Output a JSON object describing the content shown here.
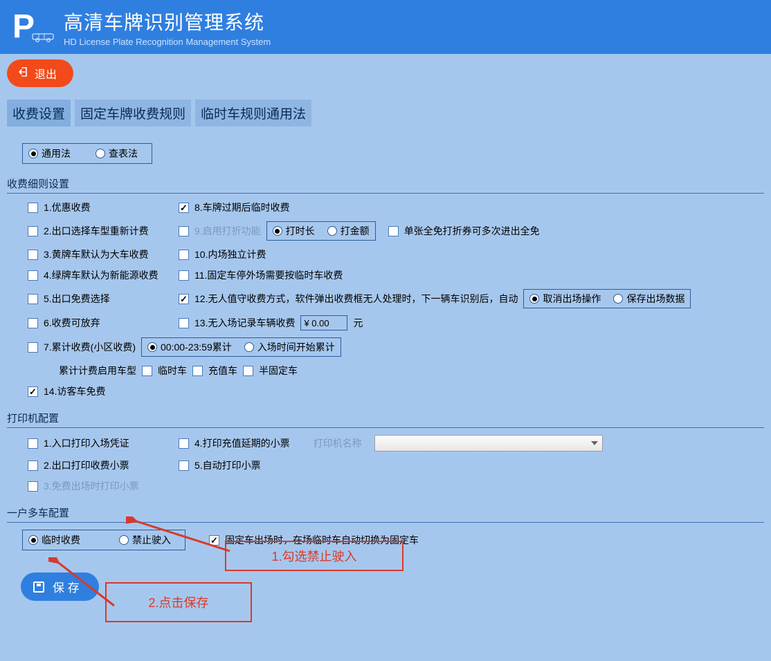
{
  "header": {
    "title_cn": "高清车牌识别管理系统",
    "title_en": "HD License Plate Recognition Management System",
    "exit_label": "退出"
  },
  "tabs": {
    "fee_settings": "收费设置",
    "fixed_plate_rules": "固定车牌收费规则",
    "temp_rules": "临时车规则通用法"
  },
  "method_radio": {
    "general": "通用法",
    "lookup": "查表法"
  },
  "sections": {
    "fee_details": "收费细则设置",
    "printer": "打印机配置",
    "multi_car": "一户多车配置"
  },
  "fee": {
    "c1": "1.优惠收费",
    "c2": "2.出口选择车型重新计费",
    "c3": "3.黄牌车默认为大车收费",
    "c4": "4.绿牌车默认为新能源收费",
    "c5": "5.出口免费选择",
    "c6": "6.收费可放弃",
    "c7": "7.累计收费(小区收费)",
    "c7_sub": "累计计费启用车型",
    "c7_r1": "00:00-23:59累计",
    "c7_r2": "入场时间开始累计",
    "c7_cb1": "临时车",
    "c7_cb2": "充值车",
    "c7_cb3": "半固定车",
    "c14": "14.访客车免费",
    "c8": "8.车牌过期后临时收费",
    "c9": "9.启用打折功能",
    "c9_r1": "打时长",
    "c9_r2": "打金额",
    "c9_extra": "单张全免打折券可多次进出全免",
    "c10": "10.内场独立计费",
    "c11": "11.固定车停外场需要按临时车收费",
    "c12": "12.无人值守收费方式，软件弹出收费框无人处理时，下一辆车识别后，自动",
    "c12_r1": "取消出场操作",
    "c12_r2": "保存出场数据",
    "c13": "13.无入场记录车辆收费",
    "c13_value": "¥ 0.00",
    "c13_unit": "元"
  },
  "printer": {
    "p1": "1.入口打印入场凭证",
    "p2": "2.出口打印收费小票",
    "p3": "3.免费出场时打印小票",
    "p4": "4.打印充值延期的小票",
    "p5": "5.自动打印小票",
    "name_label": "打印机名称"
  },
  "multi": {
    "r1": "临时收费",
    "r2": "禁止驶入",
    "cb": "固定车出场时，在场临时车自动切换为固定车"
  },
  "save_label": "保 存",
  "annotations": {
    "a1": "1.勾选禁止驶入",
    "a2": "2.点击保存"
  }
}
